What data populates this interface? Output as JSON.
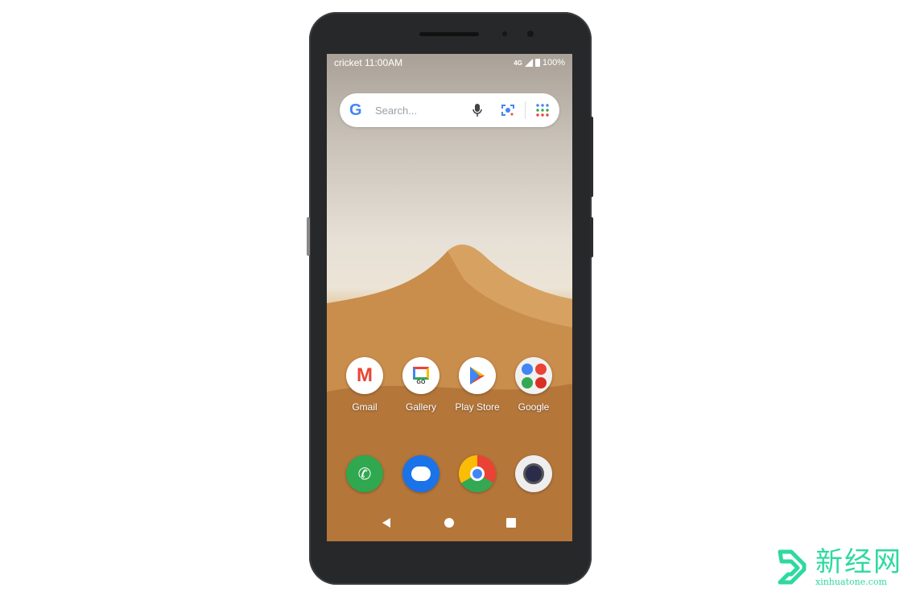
{
  "status_bar": {
    "carrier": "cricket",
    "time": "11:00AM",
    "network": "4G",
    "battery": "100%"
  },
  "search": {
    "placeholder": "Search...",
    "logo": "G",
    "icons": [
      "mic-icon",
      "lens-icon",
      "apps-grid-icon"
    ]
  },
  "apps": [
    {
      "label": "Gmail",
      "icon": "gmail-icon"
    },
    {
      "label": "Gallery",
      "icon": "gallery-go-icon",
      "badge": "GO"
    },
    {
      "label": "Play Store",
      "icon": "play-store-icon"
    },
    {
      "label": "Google",
      "icon": "google-folder-icon"
    }
  ],
  "dock": [
    {
      "icon": "phone-icon",
      "color": "#2fa84f"
    },
    {
      "icon": "messages-icon",
      "color": "#1a73e8"
    },
    {
      "icon": "chrome-icon"
    },
    {
      "icon": "camera-icon"
    }
  ],
  "nav": [
    "back-icon",
    "home-icon",
    "recents-icon"
  ],
  "watermark": {
    "name": "新经网",
    "url": "xinhuatone.com",
    "color": "#2ed9a0"
  }
}
